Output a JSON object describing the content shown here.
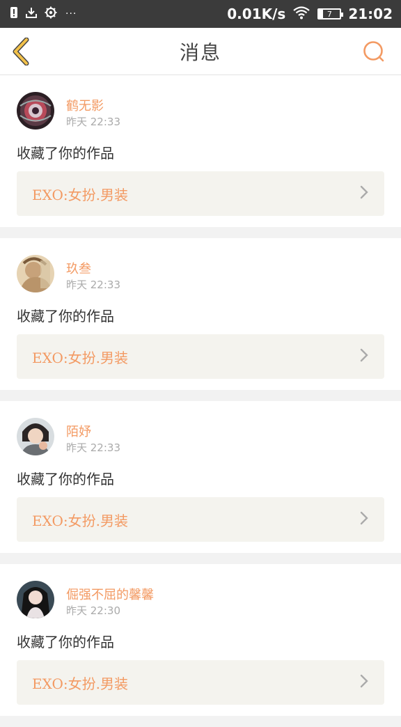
{
  "status_bar": {
    "network_speed": "0.01K/s",
    "battery_level": "7",
    "time": "21:02",
    "icons": [
      "alert-icon",
      "download-icon",
      "settings-icon",
      "more-dots-icon",
      "wifi-icon",
      "battery-icon"
    ]
  },
  "header": {
    "title": "消息",
    "back_icon": "chevron-left-icon",
    "search_icon": "search-icon",
    "accent_color": "#f39a63",
    "back_color": "#f2c14a"
  },
  "messages": [
    {
      "user": "鹤无影",
      "time": "昨天 22:33",
      "action": "收藏了你的作品",
      "work_title": "EXO:女扮.男装"
    },
    {
      "user": "玖叁",
      "time": "昨天 22:33",
      "action": "收藏了你的作品",
      "work_title": "EXO:女扮.男装"
    },
    {
      "user": "陌妤",
      "time": "昨天 22:33",
      "action": "收藏了你的作品",
      "work_title": "EXO:女扮.男装"
    },
    {
      "user": "倔强不屈的馨馨",
      "time": "昨天 22:30",
      "action": "收藏了你的作品",
      "work_title": "EXO:女扮.男装"
    }
  ]
}
